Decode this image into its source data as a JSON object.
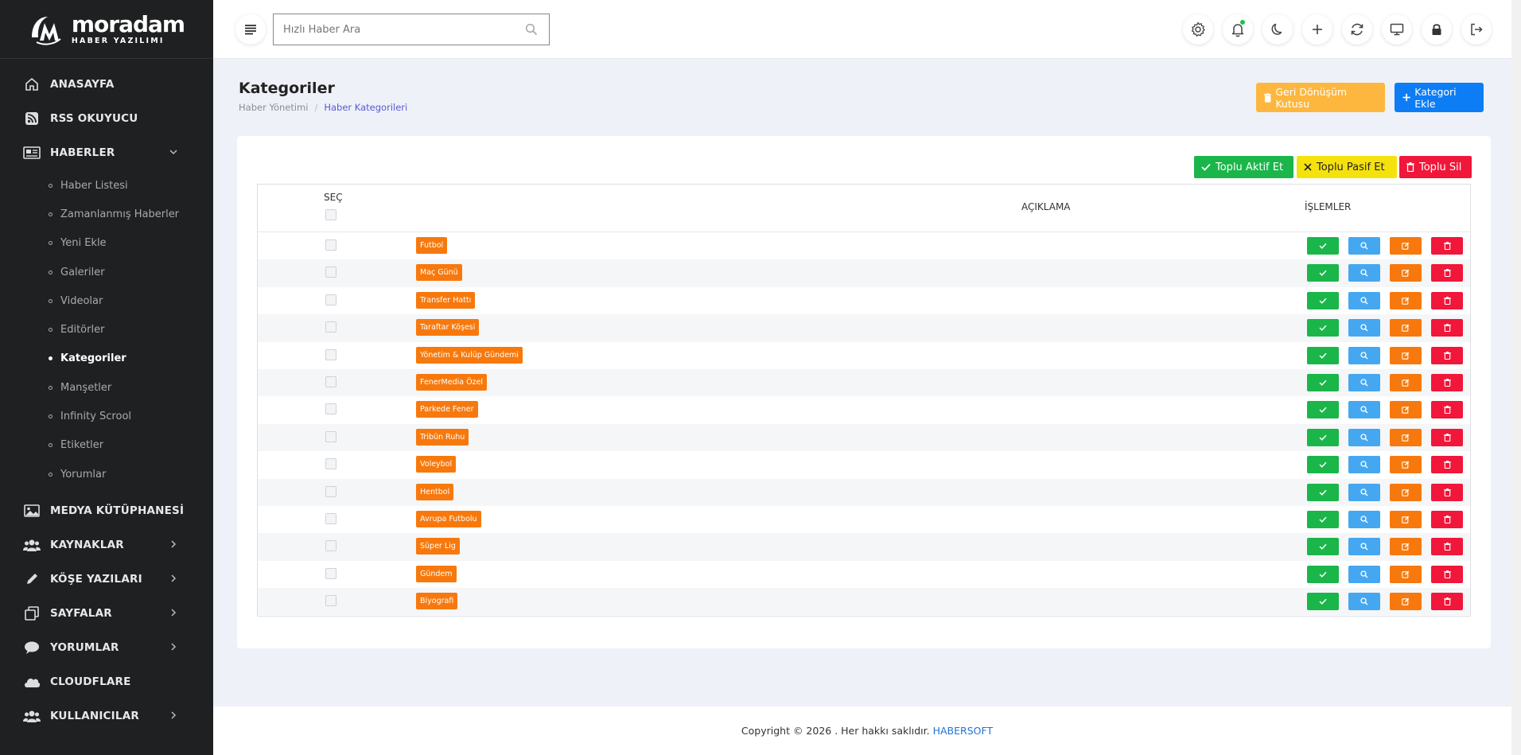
{
  "brand": {
    "name": "moradam",
    "subtitle": "HABER YAZILIMI"
  },
  "sidebar": {
    "items": [
      {
        "label": "ANASAYFA",
        "icon": "home-icon"
      },
      {
        "label": "RSS OKUYUCU",
        "icon": "rss-icon"
      },
      {
        "label": "HABERLER",
        "icon": "newspaper-icon",
        "expanded": true
      },
      {
        "label": "MEDYA KÜTÜPHANESİ",
        "icon": "image-icon"
      },
      {
        "label": "KAYNAKLAR",
        "icon": "users-icon"
      },
      {
        "label": "KÖŞE YAZILARI",
        "icon": "pen-icon"
      },
      {
        "label": "SAYFALAR",
        "icon": "pages-icon"
      },
      {
        "label": "YORUMLAR",
        "icon": "comment-icon"
      },
      {
        "label": "CLOUDFLARE",
        "icon": "cloud-icon"
      },
      {
        "label": "KULLANICILAR",
        "icon": "users-icon"
      }
    ],
    "haberler_sub": [
      "Haber Listesi",
      "Zamanlanmış Haberler",
      "Yeni Ekle",
      "Galeriler",
      "Videolar",
      "Editörler",
      "Kategoriler",
      "Manşetler",
      "Infinity Scrool",
      "Etiketler",
      "Yorumlar"
    ],
    "active_sub": "Kategoriler"
  },
  "topbar": {
    "search_placeholder": "Hızlı Haber Ara",
    "icons": [
      "gear-icon",
      "bell-icon",
      "moon-icon",
      "plus-icon",
      "refresh-icon",
      "monitor-icon",
      "lock-icon",
      "logout-icon"
    ]
  },
  "page": {
    "title": "Kategoriler",
    "breadcrumb": [
      "Haber Yönetimi",
      "Haber Kategorileri"
    ],
    "recycle_label": "Geri Dönüşüm Kutusu",
    "add_label": "Kategori Ekle"
  },
  "bulk": {
    "aktif": "Toplu Aktif Et",
    "pasif": "Toplu Pasif Et",
    "sil": "Toplu Sil"
  },
  "table": {
    "headers": {
      "select": "SEÇ",
      "description": "AÇIKLAMA",
      "actions": "İŞLEMLER"
    },
    "rows": [
      "Futbol",
      "Maç Günü",
      "Transfer Hattı",
      "Taraftar Köşesi",
      "Yönetim & Kulüp Gündemi",
      "FenerMedia Özel",
      "Parkede Fener",
      "Tribün Ruhu",
      "Voleybol",
      "Hentbol",
      "Avrupa Futbolu",
      "Süper Lig",
      "Gündem",
      "Biyografi"
    ]
  },
  "footer": {
    "text": "Copyright © 2026 . Her hakkı saklıdır.",
    "brand": "HABERSOFT"
  },
  "colors": {
    "sidebar": "#1f2021",
    "tag": "#f7790d",
    "success": "#1ab649",
    "info": "#45a7f0",
    "danger": "#f0173a",
    "warning": "#f5e20c",
    "primary": "#0d7df6",
    "recycle": "#fdb73e"
  }
}
